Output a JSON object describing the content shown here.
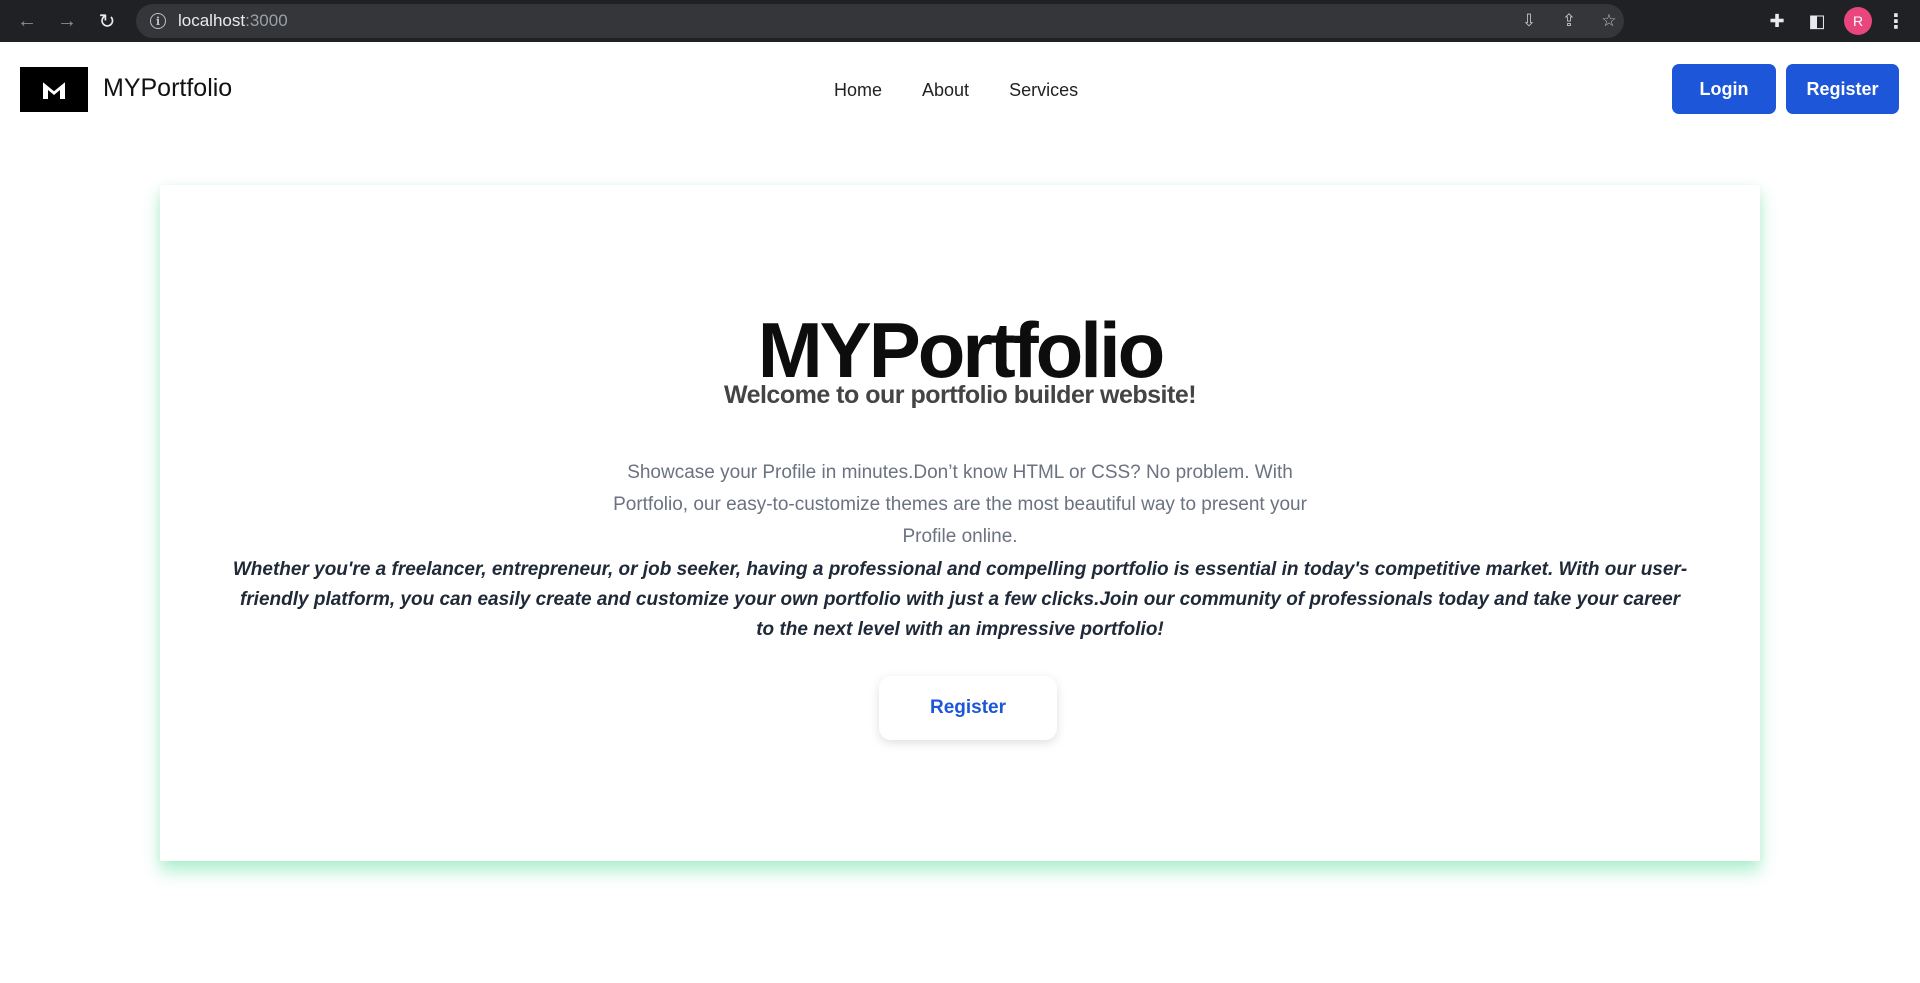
{
  "browser": {
    "back_icon": "←",
    "forward_icon": "→",
    "reload_icon": "↻",
    "url_host": "localhost",
    "url_port": ":3000",
    "info_icon": "i",
    "install_icon": "⇩",
    "share_icon": "⇪",
    "star_icon": "☆",
    "extensions_icon": "✚",
    "sidepanel_icon": "◧",
    "profile_initial": "R",
    "menu_icon": "⋮"
  },
  "header": {
    "brand": "MYPortfolio",
    "nav": [
      "Home",
      "About",
      "Services"
    ],
    "login_label": "Login",
    "register_label": "Register"
  },
  "hero": {
    "title": "MYPortfolio",
    "subtitle": "Welcome to our portfolio builder website!",
    "description": "Showcase your Profile in minutes.Don’t know HTML or CSS? No problem. With Portfolio, our easy-to-customize themes are the most beautiful way to present your Profile online.",
    "extra": "Whether you're a freelancer, entrepreneur, or job seeker, having a professional and compelling portfolio is essential in today's competitive market. With our user-friendly platform, you can easily create and customize your own portfolio with just a few clicks.Join our community of professionals today and take your career to the next level with an impressive portfolio!",
    "register_label": "Register"
  },
  "colors": {
    "accent": "#1d56d8",
    "card_glow": "#4ade94",
    "avatar": "#e8467c"
  }
}
